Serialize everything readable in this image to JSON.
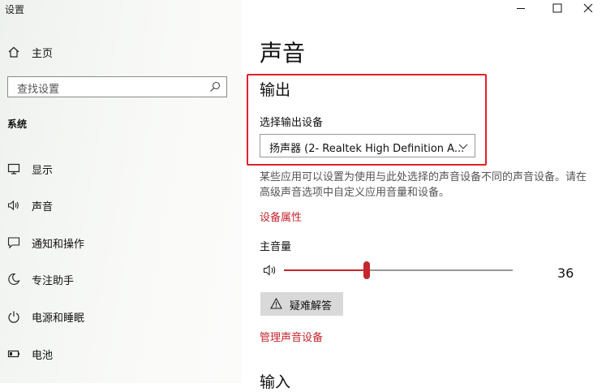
{
  "window": {
    "title": "设置"
  },
  "sidebar": {
    "home_label": "主页",
    "search_placeholder": "查找设置",
    "section_label": "系统",
    "items": [
      {
        "label": "显示",
        "icon": "monitor-icon"
      },
      {
        "label": "声音",
        "icon": "speaker-icon"
      },
      {
        "label": "通知和操作",
        "icon": "notification-icon"
      },
      {
        "label": "专注助手",
        "icon": "moon-icon"
      },
      {
        "label": "电源和睡眠",
        "icon": "power-icon"
      },
      {
        "label": "电池",
        "icon": "battery-icon"
      }
    ]
  },
  "main": {
    "title": "声音",
    "output": {
      "title": "输出",
      "device_label": "选择输出设备",
      "device_value": "扬声器 (2- Realtek High Definition A...",
      "description": "某些应用可以设置为使用与此处选择的声音设备不同的声音设备。请在高级声音选项中自定义应用音量和设备。",
      "device_properties_link": "设备属性",
      "master_volume_label": "主音量",
      "volume_value": "36",
      "volume_fraction": 0.36,
      "troubleshoot_label": "疑难解答",
      "manage_devices_link": "管理声音设备"
    },
    "input": {
      "title": "输入"
    }
  },
  "colors": {
    "accent": "#c4262e",
    "highlight": "#e0202a"
  }
}
